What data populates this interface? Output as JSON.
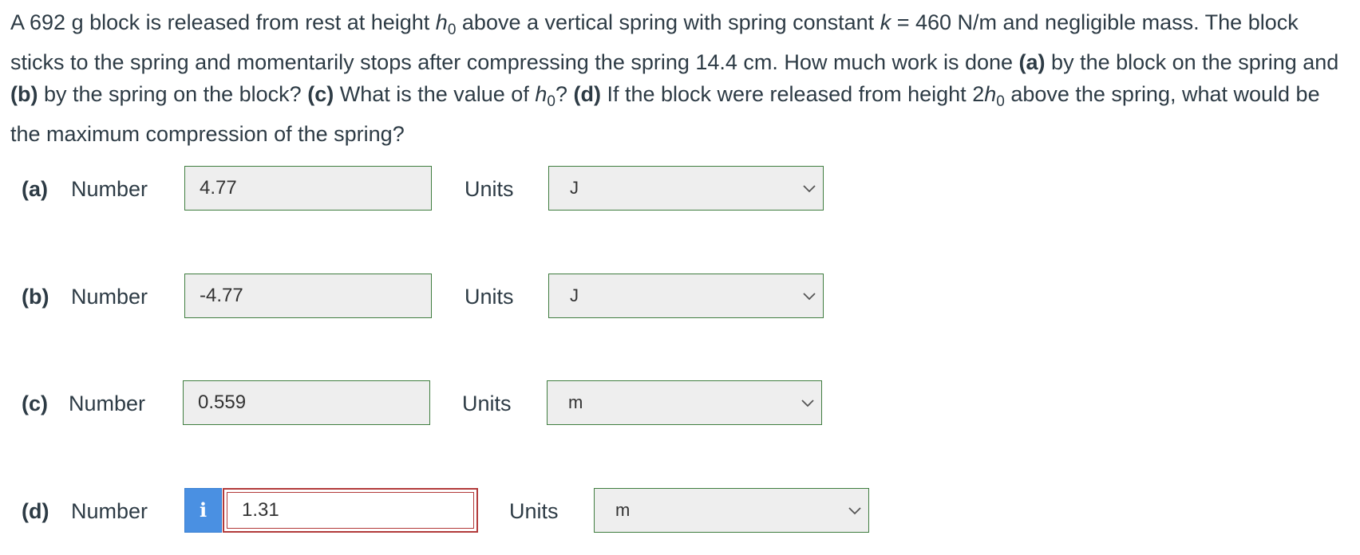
{
  "question": {
    "t1": "A 692 g block is released from rest at height ",
    "h": "h",
    "sub0": "0",
    "t2": " above a vertical spring with spring constant ",
    "k": "k",
    "t3": " = 460 N/m and negligible mass. The block sticks to the spring and momentarily stops after compressing the spring 14.4 cm. How much work is done ",
    "a_label": "(a)",
    "t4": " by the block on the spring and ",
    "b_label": "(b)",
    "t5": " by the spring on the block? ",
    "c_label": "(c)",
    "t6": " What is the value of ",
    "t7": "? ",
    "d_label": "(d)",
    "t8": " If the block were released from height 2",
    "t9": " above the spring, what would be the maximum compression of the spring?"
  },
  "parts": [
    {
      "label": "(a)",
      "number_label": "Number",
      "value": "4.77",
      "units_label": "Units",
      "unit": "J"
    },
    {
      "label": "(b)",
      "number_label": "Number",
      "value": "-4.77",
      "units_label": "Units",
      "unit": "J"
    },
    {
      "label": "(c)",
      "number_label": "Number",
      "value": "0.559",
      "units_label": "Units",
      "unit": "m"
    },
    {
      "label": "(d)",
      "number_label": "Number",
      "value": "1.31",
      "units_label": "Units",
      "unit": "m",
      "info": "i"
    }
  ],
  "colors": {
    "text": "#2d3b45",
    "correct_border": "#3f7d3f",
    "incorrect_border": "#b23a3a",
    "info_button": "#4a90e2",
    "field_bg": "#eeeeee"
  },
  "icons": {
    "dropdown": "chevron-down-icon",
    "info": "info-icon"
  }
}
